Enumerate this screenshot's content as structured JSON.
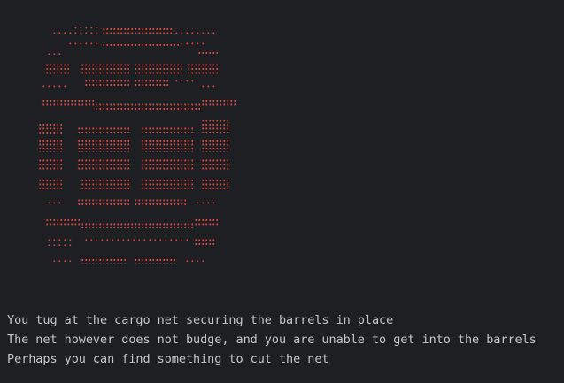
{
  "terminal": {
    "background": "#1e1f22",
    "text_color": "#c4c7cc"
  },
  "ascii_art": {
    "subject": "barrel",
    "color": "#d9473f"
  },
  "output": {
    "lines": [
      "You tug at the cargo net securing the barrels in place",
      "The net however does not budge, and you are unable to get into the barrels",
      "Perhaps you can find something to cut the net"
    ]
  }
}
